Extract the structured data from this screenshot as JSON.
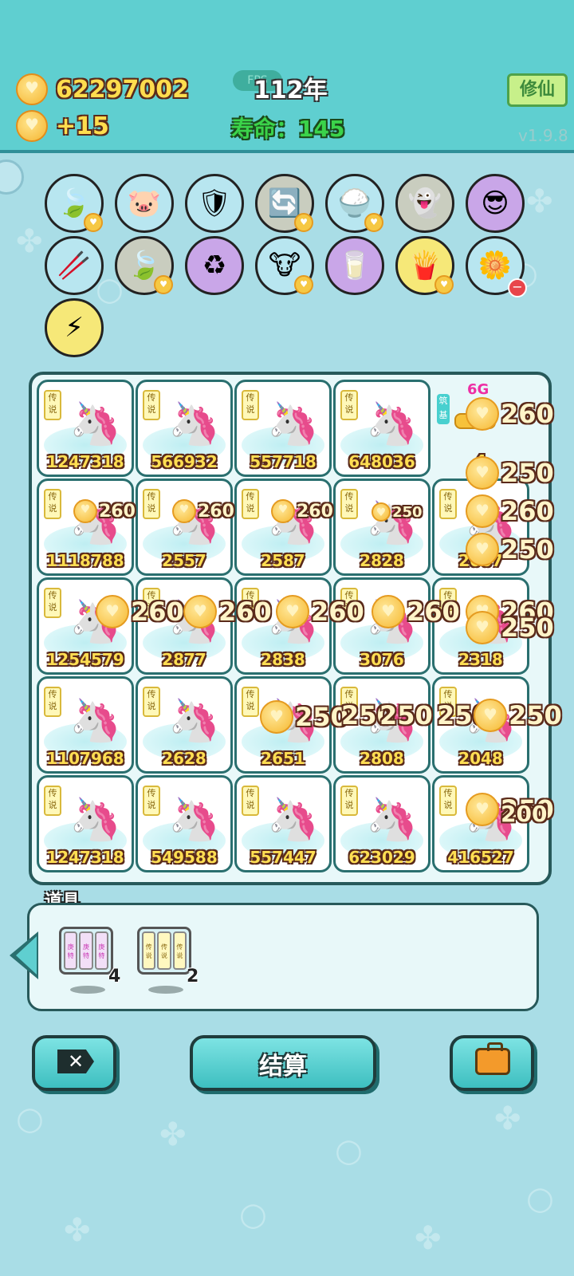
{
  "header": {
    "coins": "62297002",
    "income": "+15",
    "fps_label": "FPS",
    "year": "112年",
    "lifespan": "寿命：145",
    "xiuxian_button": "修仙",
    "version": "v1.9.8"
  },
  "relics": [
    {
      "name": "leaf",
      "emoji": "🍃",
      "bg": "#b8e6f0"
    },
    {
      "name": "piggy-bank",
      "emoji": "🐷",
      "bg": "#b8e6f0"
    },
    {
      "name": "wrench-shield",
      "emoji": "🛡",
      "bg": "#b8e6f0"
    },
    {
      "name": "recycle-arrows",
      "emoji": "🔄",
      "bg": "#c9cdbf"
    },
    {
      "name": "rice-bowl",
      "emoji": "🍚",
      "bg": "#b8e6f0"
    },
    {
      "name": "ghost",
      "emoji": "👻",
      "bg": "#c9cdbf"
    },
    {
      "name": "math-face",
      "emoji": "😎",
      "bg": "#c9a6e8"
    },
    {
      "name": "sticks",
      "emoji": "🥢",
      "bg": "#b8e6f0"
    },
    {
      "name": "leaf-2",
      "emoji": "🍃",
      "bg": "#c9cdbf"
    },
    {
      "name": "recycle",
      "emoji": "♻",
      "bg": "#c9a6e8"
    },
    {
      "name": "cows",
      "emoji": "🐮",
      "bg": "#b8e6f0"
    },
    {
      "name": "milk-jar",
      "emoji": "🥛",
      "bg": "#c9a6e8"
    },
    {
      "name": "fries",
      "emoji": "🍟",
      "bg": "#f6e878"
    },
    {
      "name": "flower-pot",
      "emoji": "🌼",
      "bg": "#b8e6f0"
    },
    {
      "name": "lightning",
      "emoji": "⚡",
      "bg": "#f6e878"
    }
  ],
  "board": {
    "tag": "传说",
    "rows": [
      [
        "1247318",
        "566932",
        "557718",
        "648036",
        ""
      ],
      [
        "1118788",
        "2557",
        "2587",
        "2828",
        "2067"
      ],
      [
        "1254579",
        "2877",
        "2838",
        "3076",
        "2318"
      ],
      [
        "1107968",
        "2628",
        "2651",
        "2808",
        "2048"
      ],
      [
        "1247318",
        "549588",
        "557447",
        "623029",
        "416527"
      ]
    ],
    "special": {
      "zhuji": "筑基",
      "label": "6G",
      "value": "4"
    }
  },
  "floats": {
    "a": "260",
    "b": "250",
    "c": "260",
    "d": "250",
    "e": "260",
    "f": "250",
    "g": "260",
    "h": "260",
    "i": "260",
    "j": "260",
    "k": "260",
    "l": "260",
    "m": "260",
    "n": "250",
    "o": "250",
    "p": "250",
    "q": "250",
    "r": "250",
    "s": "250",
    "t": "250",
    "u": "200"
  },
  "items": {
    "title": "道具",
    "list": [
      {
        "glyph": "庚特",
        "count": "4"
      },
      {
        "glyph": "传说",
        "count": "2"
      }
    ]
  },
  "buttons": {
    "settle": "结算"
  }
}
